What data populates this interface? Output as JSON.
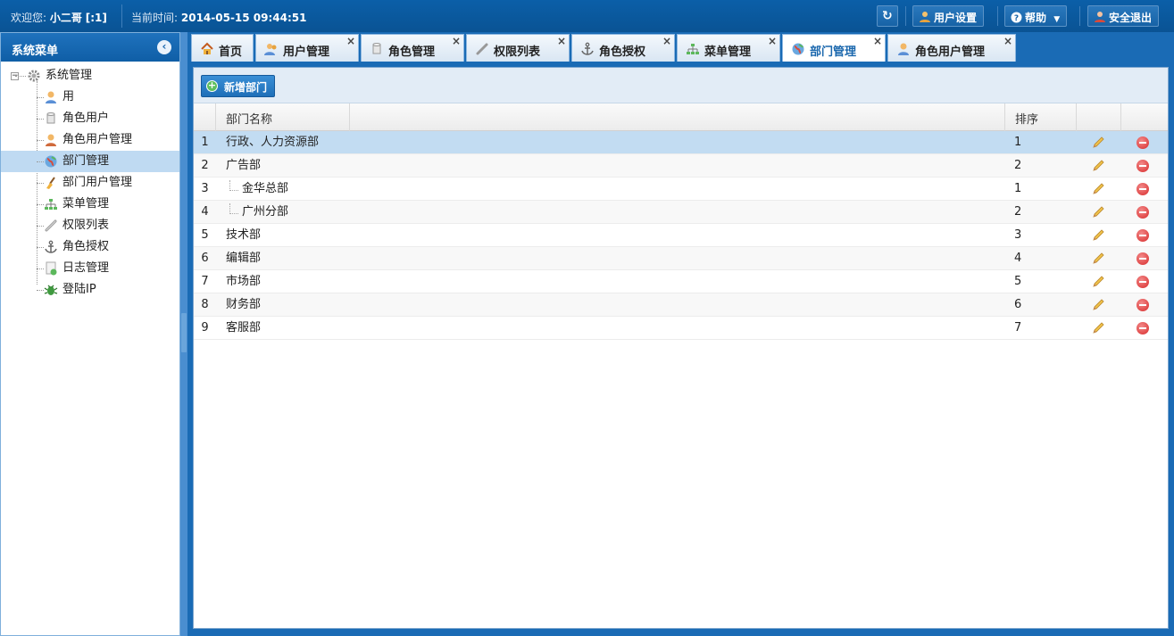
{
  "topbar": {
    "welcome_label": "欢迎您:",
    "user_name": "小二哥",
    "user_tag": "[:1]",
    "time_label": "当前时间:",
    "time_value": "2014-05-15 09:44:51",
    "buttons": {
      "user_settings": "用户设置",
      "help": "帮助",
      "logout": "安全退出"
    }
  },
  "sidebar": {
    "title": "系统菜单",
    "root": "系统管理",
    "items": [
      {
        "label": "用",
        "icon": "user-icon"
      },
      {
        "label": "角色用户",
        "icon": "cylinder-icon"
      },
      {
        "label": "角色用户管理",
        "icon": "user-manage-icon"
      },
      {
        "label": "部门管理",
        "icon": "globe-icon"
      },
      {
        "label": "部门用户管理",
        "icon": "broom-icon"
      },
      {
        "label": "菜单管理",
        "icon": "sitemap-icon"
      },
      {
        "label": "权限列表",
        "icon": "link-icon"
      },
      {
        "label": "角色授权",
        "icon": "anchor-icon"
      },
      {
        "label": "日志管理",
        "icon": "log-icon"
      },
      {
        "label": "登陆IP",
        "icon": "bug-icon"
      }
    ]
  },
  "tabs": [
    {
      "label": "首页",
      "icon": "home-icon",
      "closable": false
    },
    {
      "label": "用户管理",
      "icon": "users-icon",
      "closable": true
    },
    {
      "label": "角色管理",
      "icon": "cylinder-icon",
      "closable": true
    },
    {
      "label": "权限列表",
      "icon": "link-icon",
      "closable": true
    },
    {
      "label": "角色授权",
      "icon": "anchor-icon",
      "closable": true
    },
    {
      "label": "菜单管理",
      "icon": "sitemap-icon",
      "closable": true
    },
    {
      "label": "部门管理",
      "icon": "globe-icon",
      "closable": true,
      "active": true
    },
    {
      "label": "角色用户管理",
      "icon": "user-manage-icon",
      "closable": true
    }
  ],
  "toolbar": {
    "add_label": "新增部门"
  },
  "grid": {
    "headers": {
      "name": "部门名称",
      "sort": "排序"
    },
    "rows": [
      {
        "num": "1",
        "name": "行政、人力资源部",
        "sort": "1",
        "child": false
      },
      {
        "num": "2",
        "name": "广告部",
        "sort": "2",
        "child": false
      },
      {
        "num": "3",
        "name": "金华总部",
        "sort": "1",
        "child": true
      },
      {
        "num": "4",
        "name": "广州分部",
        "sort": "2",
        "child": true
      },
      {
        "num": "5",
        "name": "技术部",
        "sort": "3",
        "child": false
      },
      {
        "num": "6",
        "name": "编辑部",
        "sort": "4",
        "child": false
      },
      {
        "num": "7",
        "name": "市场部",
        "sort": "5",
        "child": false
      },
      {
        "num": "8",
        "name": "财务部",
        "sort": "6",
        "child": false
      },
      {
        "num": "9",
        "name": "客服部",
        "sort": "7",
        "child": false
      }
    ]
  },
  "colors": {
    "brand": "#0b5fa8",
    "selected_row": "#c2dcf2",
    "tab_bar": "#1a6bb5"
  }
}
